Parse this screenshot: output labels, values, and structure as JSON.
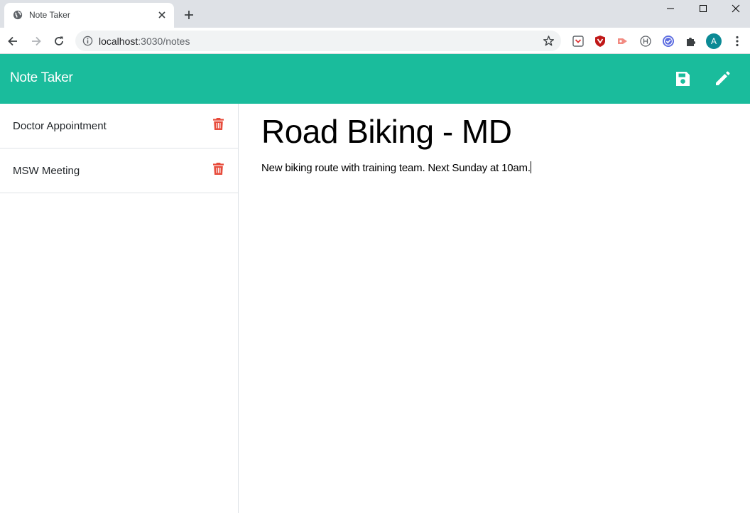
{
  "browser": {
    "tab": {
      "title": "Note Taker"
    },
    "address": {
      "host": "localhost",
      "rest": ":3030/notes"
    },
    "profile_initial": "A"
  },
  "app": {
    "brand": "Note Taker",
    "accent_color": "#1abc9c",
    "delete_color": "#e74c3c",
    "actions": [
      "save-icon",
      "pen-icon"
    ]
  },
  "notes": [
    {
      "title": "Doctor Appointment"
    },
    {
      "title": "MSW Meeting"
    }
  ],
  "editor": {
    "title": "Road Biking - MD",
    "text": "New biking route with training team. Next Sunday at 10am."
  }
}
